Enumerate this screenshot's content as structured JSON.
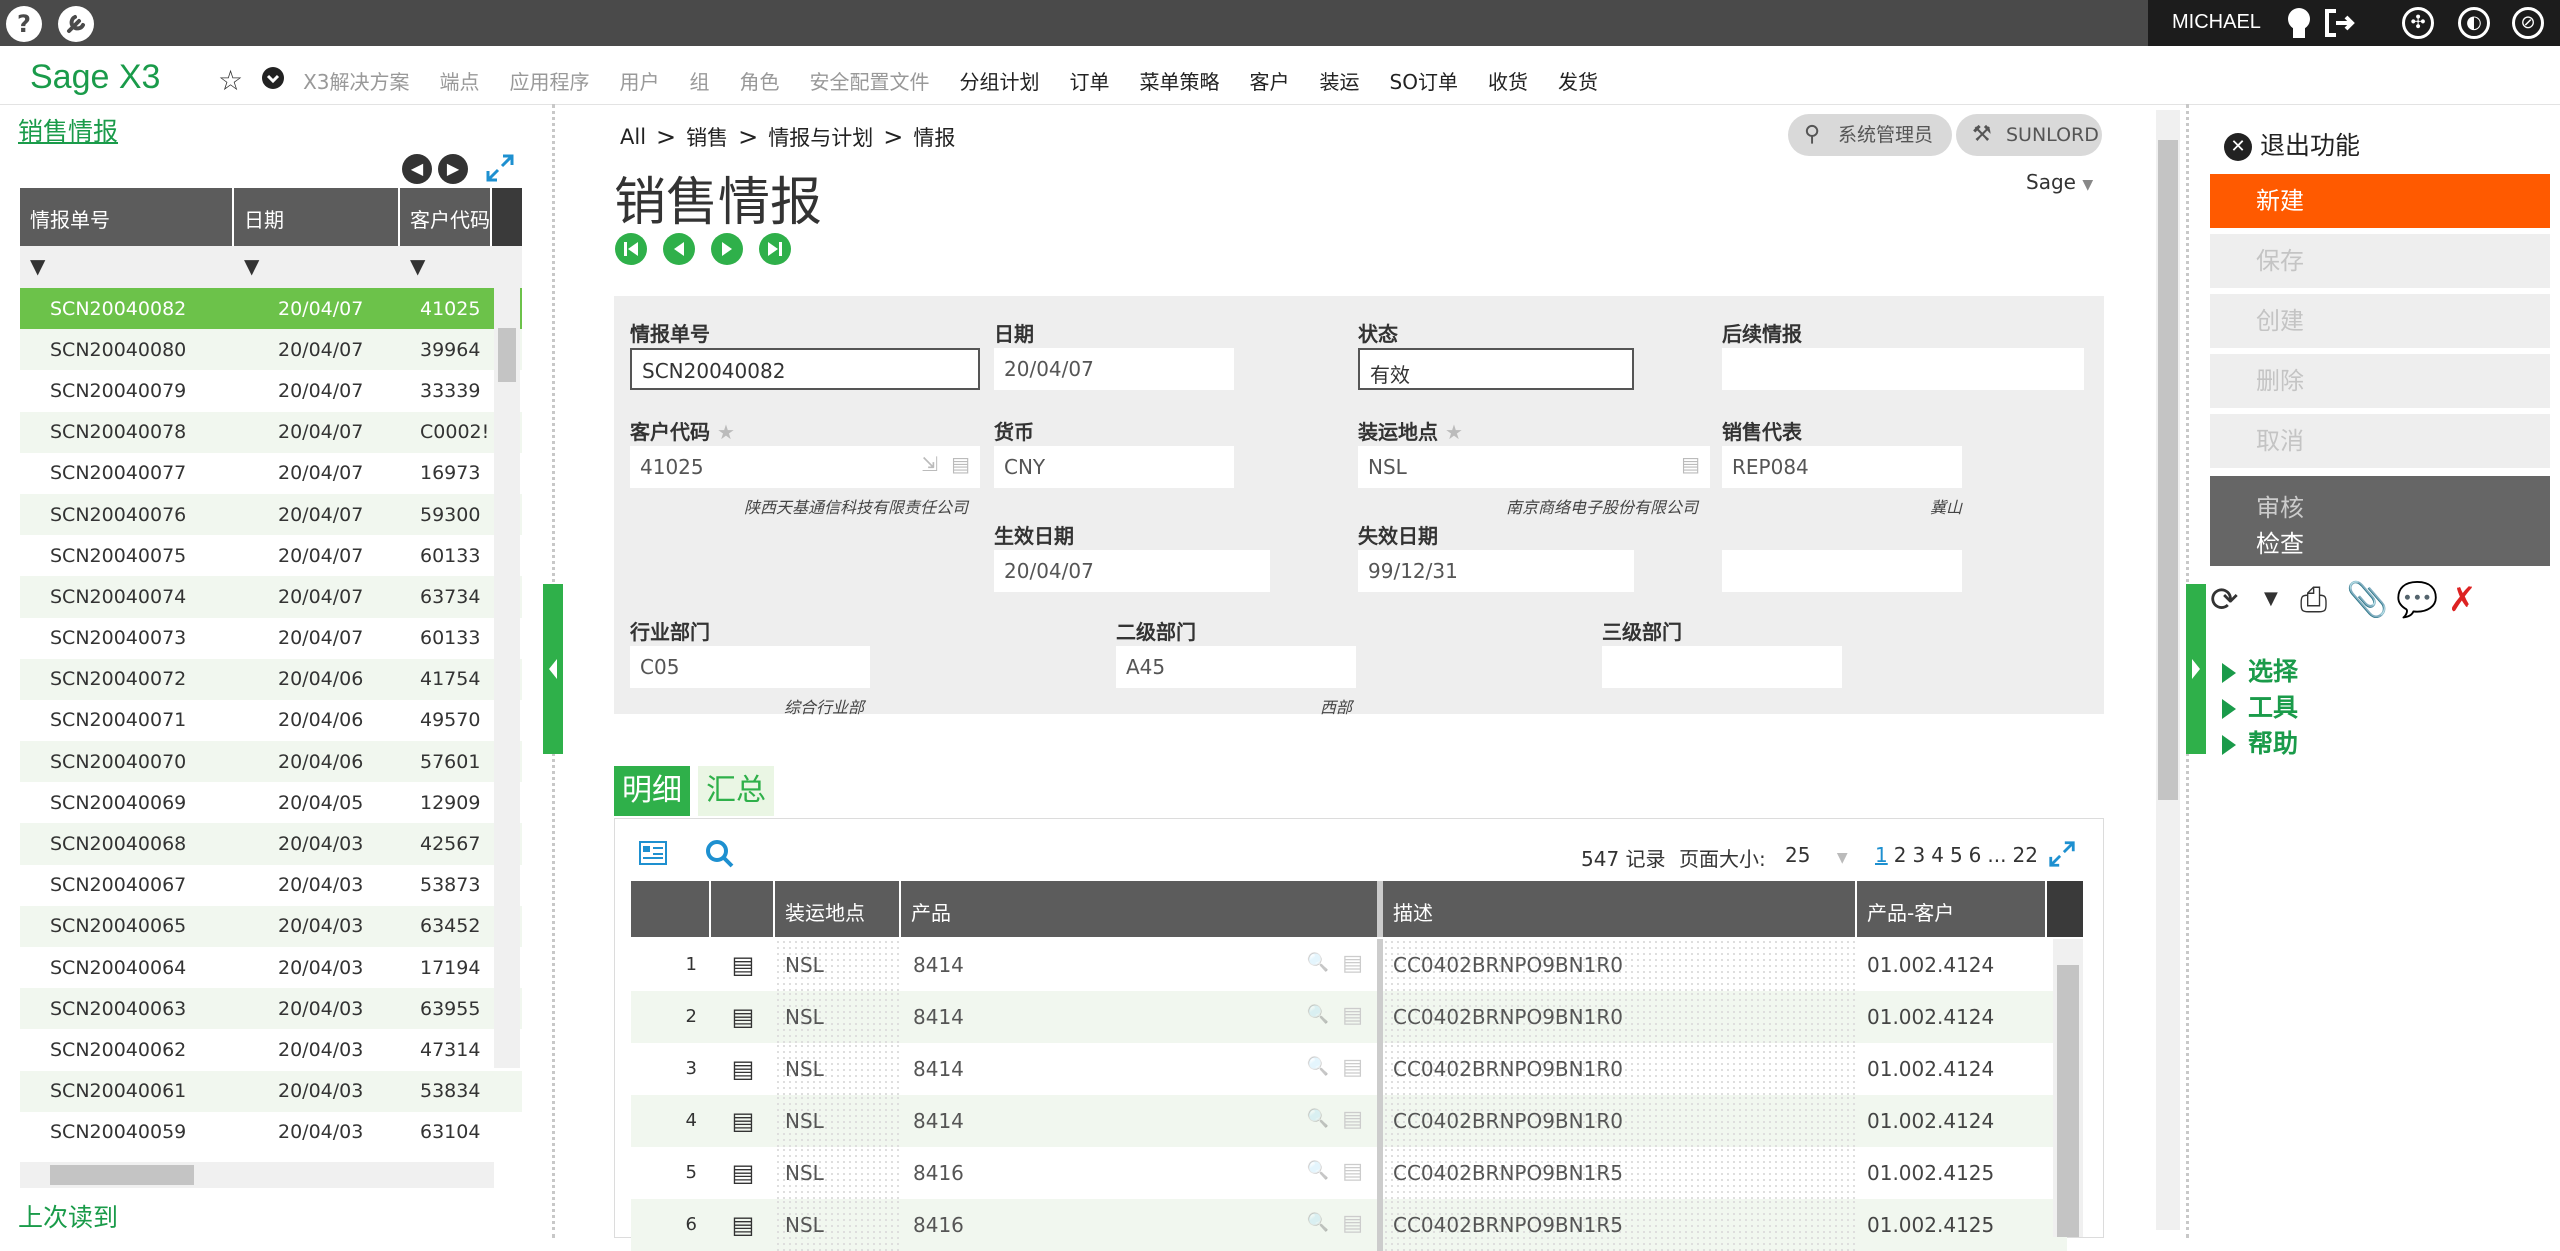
{
  "topbar": {
    "help_icon": "?",
    "user": "MICHAEL"
  },
  "menu": {
    "logo": "Sage X3",
    "items": [
      "X3解决方案",
      "端点",
      "应用程序",
      "用户",
      "组",
      "角色",
      "安全配置文件",
      "分组计划",
      "订单",
      "菜单策略",
      "客户",
      "装运",
      "SO订单",
      "收货",
      "发货"
    ]
  },
  "left": {
    "title": "销售情报",
    "columns": [
      "情报单号",
      "日期",
      "客户代码"
    ],
    "rows": [
      [
        "SCN20040082",
        "20/04/07",
        "41025"
      ],
      [
        "SCN20040080",
        "20/04/07",
        "39964"
      ],
      [
        "SCN20040079",
        "20/04/07",
        "33339"
      ],
      [
        "SCN20040078",
        "20/04/07",
        "C0002!"
      ],
      [
        "SCN20040077",
        "20/04/07",
        "16973"
      ],
      [
        "SCN20040076",
        "20/04/07",
        "59300"
      ],
      [
        "SCN20040075",
        "20/04/07",
        "60133"
      ],
      [
        "SCN20040074",
        "20/04/07",
        "63734"
      ],
      [
        "SCN20040073",
        "20/04/07",
        "60133"
      ],
      [
        "SCN20040072",
        "20/04/06",
        "41754"
      ],
      [
        "SCN20040071",
        "20/04/06",
        "49570"
      ],
      [
        "SCN20040070",
        "20/04/06",
        "57601"
      ],
      [
        "SCN20040069",
        "20/04/05",
        "12909"
      ],
      [
        "SCN20040068",
        "20/04/03",
        "42567"
      ],
      [
        "SCN20040067",
        "20/04/03",
        "53873"
      ],
      [
        "SCN20040065",
        "20/04/03",
        "63452"
      ],
      [
        "SCN20040064",
        "20/04/03",
        "17194"
      ],
      [
        "SCN20040063",
        "20/04/03",
        "63955"
      ],
      [
        "SCN20040062",
        "20/04/03",
        "47314"
      ],
      [
        "SCN20040061",
        "20/04/03",
        "53834"
      ],
      [
        "SCN20040059",
        "20/04/03",
        "63104"
      ]
    ],
    "footer": "上次读到"
  },
  "breadcrumb": [
    "All",
    "销售",
    "情报与计划",
    "情报"
  ],
  "page": {
    "title": "销售情报",
    "admin_label": "系统管理员",
    "company_label": "SUNLORD",
    "sage_label": "Sage"
  },
  "form": {
    "no_label": "情报单号",
    "no_value": "SCN20040082",
    "date_label": "日期",
    "date_value": "20/04/07",
    "status_label": "状态",
    "status_value": "有效",
    "follow_label": "后续情报",
    "follow_value": "",
    "customer_label": "客户代码",
    "customer_value": "41025",
    "customer_name": "陕西天基通信科技有限责任公司",
    "currency_label": "货币",
    "currency_value": "CNY",
    "site_label": "装运地点",
    "site_value": "NSL",
    "site_name": "南京商络电子股份有限公司",
    "rep_label": "销售代表",
    "rep_value": "REP084",
    "rep_name": "冀山",
    "start_label": "生效日期",
    "start_value": "20/04/07",
    "end_label": "失效日期",
    "end_value": "99/12/31",
    "industry_label": "行业部门",
    "industry_value": "C05",
    "industry_name": "综合行业部",
    "sub2_label": "二级部门",
    "sub2_value": "A45",
    "sub2_name": "西部",
    "sub3_label": "三级部门",
    "sub3_value": ""
  },
  "tabs": [
    "明细",
    "汇总"
  ],
  "detail": {
    "records": "547 记录",
    "page_size_label": "页面大小:",
    "page_size": "25",
    "pages": [
      "1",
      "2",
      "3",
      "4",
      "5",
      "6",
      "...",
      "22"
    ],
    "columns": [
      "装运地点",
      "产品",
      "描述",
      "产品-客户"
    ],
    "rows": [
      {
        "n": "1",
        "site": "NSL",
        "product": "8414",
        "desc": "CC0402BRNPO9BN1R0",
        "cust": "01.002.4124"
      },
      {
        "n": "2",
        "site": "NSL",
        "product": "8414",
        "desc": "CC0402BRNPO9BN1R0",
        "cust": "01.002.4124"
      },
      {
        "n": "3",
        "site": "NSL",
        "product": "8414",
        "desc": "CC0402BRNPO9BN1R0",
        "cust": "01.002.4124"
      },
      {
        "n": "4",
        "site": "NSL",
        "product": "8414",
        "desc": "CC0402BRNPO9BN1R0",
        "cust": "01.002.4124"
      },
      {
        "n": "5",
        "site": "NSL",
        "product": "8416",
        "desc": "CC0402BRNPO9BN1R5",
        "cust": "01.002.4125"
      },
      {
        "n": "6",
        "site": "NSL",
        "product": "8416",
        "desc": "CC0402BRNPO9BN1R5",
        "cust": "01.002.4125"
      }
    ]
  },
  "actions": {
    "exit": "退出功能",
    "new": "新建",
    "save": "保存",
    "create": "创建",
    "delete": "删除",
    "cancel": "取消",
    "audit": "审核",
    "check": "检查",
    "sections": [
      "选择",
      "工具",
      "帮助"
    ]
  },
  "colors": {
    "accent_green": "#1a9b4a",
    "selected_row": "#6cc24a",
    "new_button": "#ff5a00",
    "header_dark": "#4a4a4a"
  }
}
